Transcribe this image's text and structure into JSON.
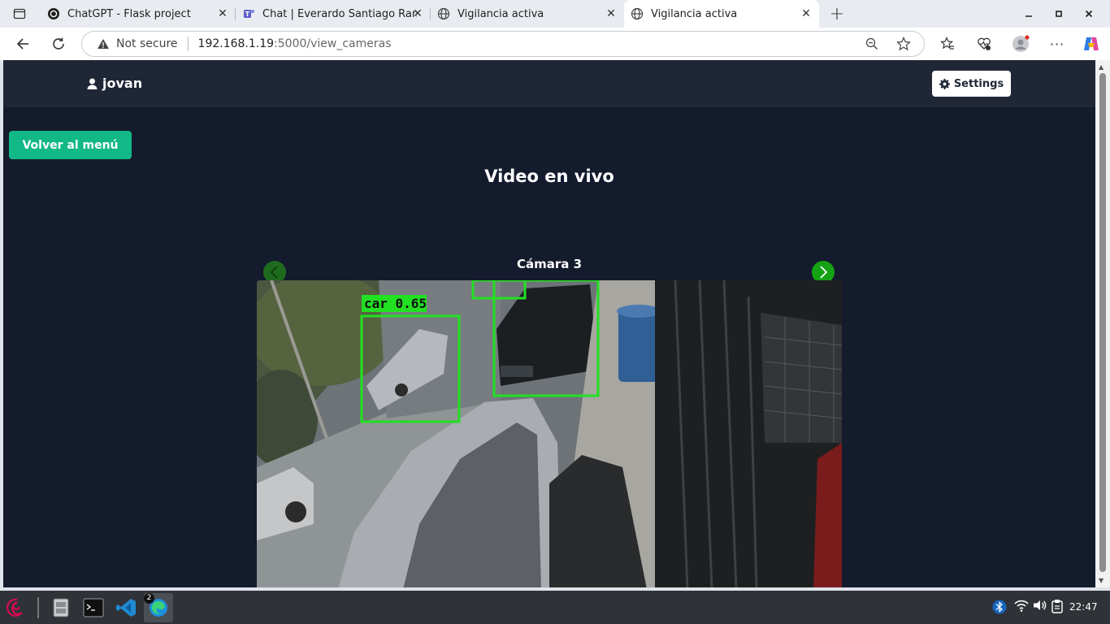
{
  "browser": {
    "tabs": [
      {
        "title": "ChatGPT - Flask project",
        "icon": "chatgpt-icon"
      },
      {
        "title": "Chat | Everardo Santiago Ramir",
        "icon": "teams-icon"
      },
      {
        "title": "Vigilancia activa",
        "icon": "globe-icon"
      },
      {
        "title": "Vigilancia activa",
        "icon": "globe-icon",
        "active": true
      }
    ],
    "address": {
      "security_label": "Not secure",
      "host": "192.168.1.19",
      "path": ":5000/view_cameras"
    }
  },
  "page": {
    "username": "jovan",
    "settings_label": "Settings",
    "back_label": "Volver al menú",
    "title": "Video en vivo",
    "camera_label": "Cámara 3"
  },
  "video": {
    "detections": [
      {
        "label": "car 0.65"
      }
    ]
  },
  "taskbar": {
    "clock": "22:47",
    "edge_badge": "2"
  },
  "colors": {
    "page_bg": "#141b2d",
    "navbar_bg": "#1f2737",
    "accent_green": "#12b886",
    "detection_green": "#22e022"
  }
}
